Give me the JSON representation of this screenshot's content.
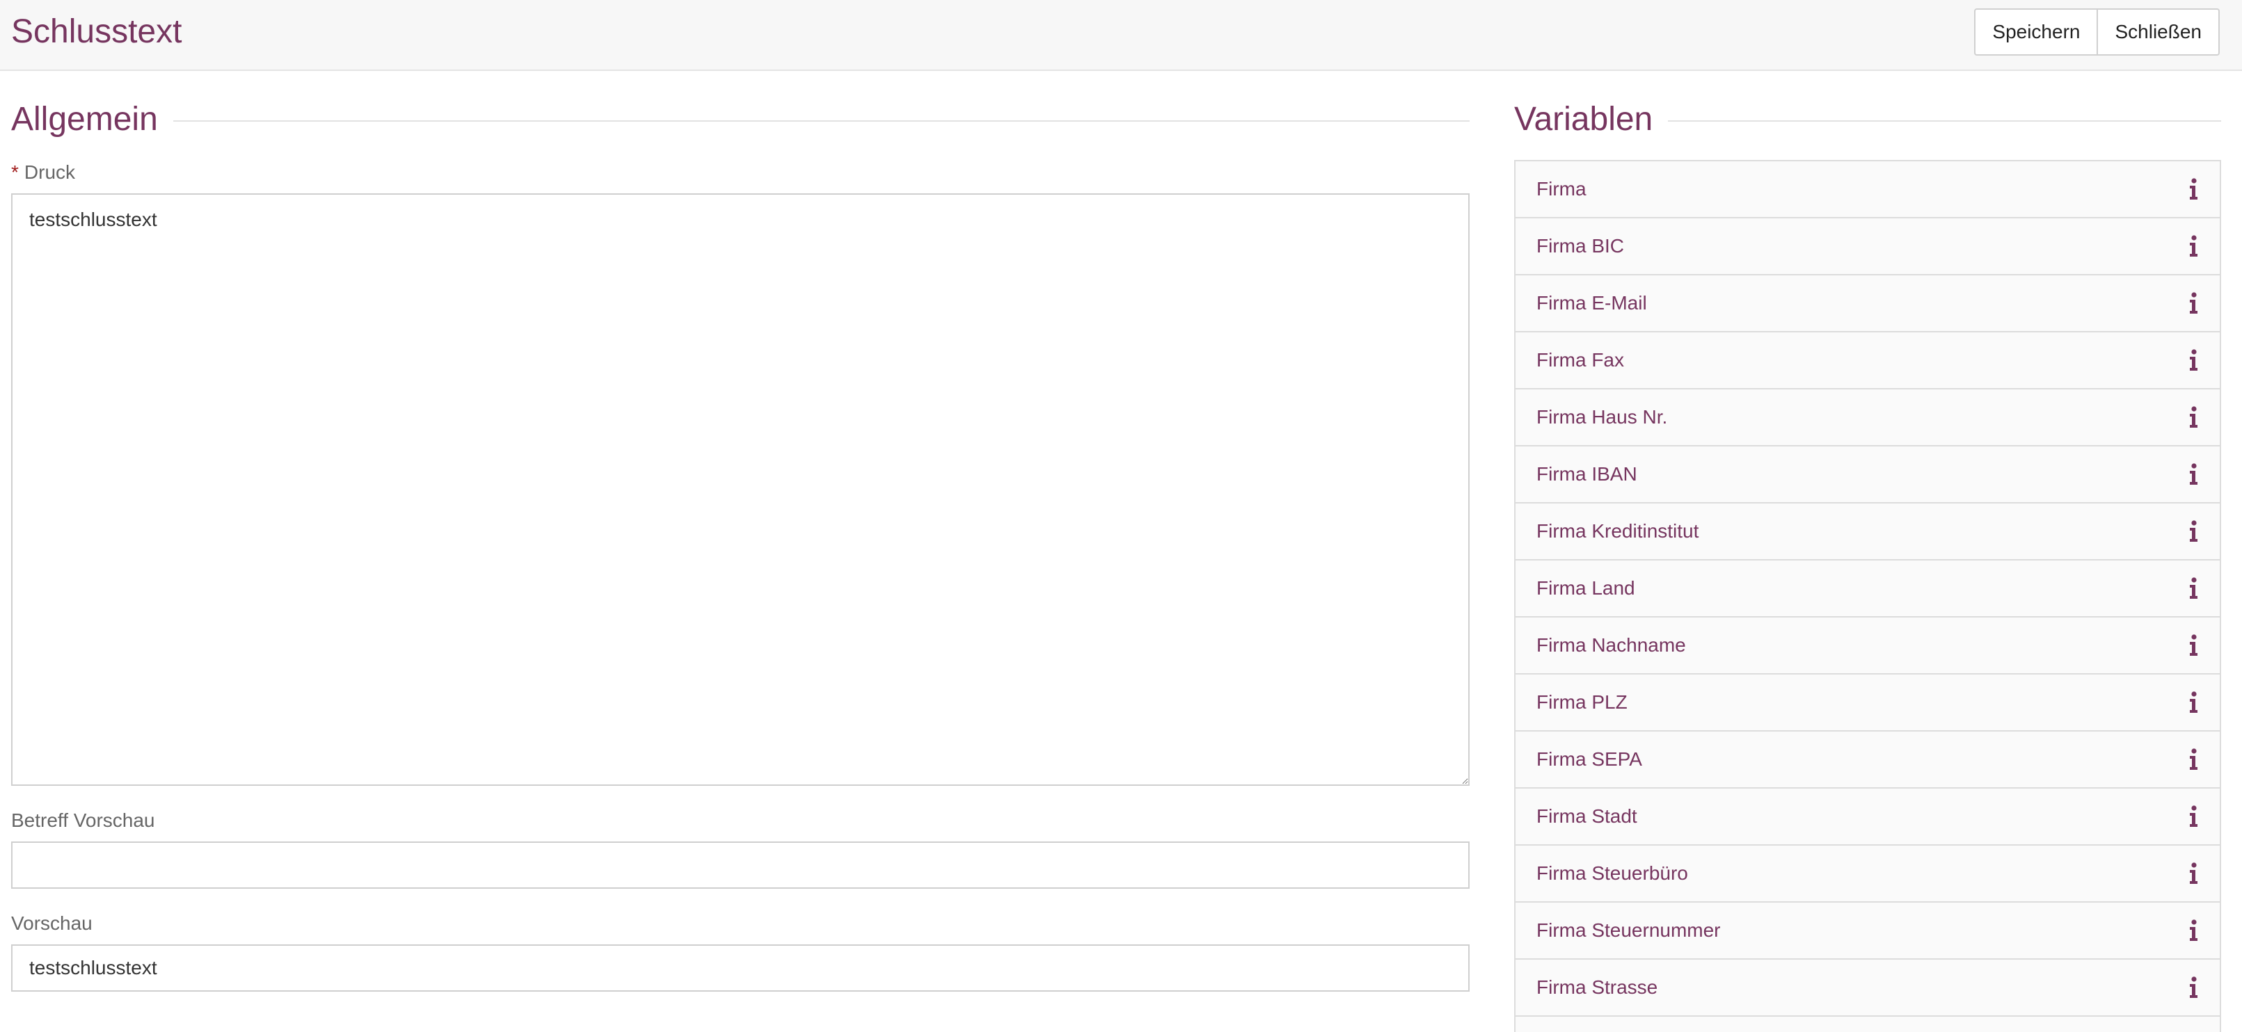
{
  "header": {
    "title": "Schlusstext",
    "save_label": "Speichern",
    "close_label": "Schließen"
  },
  "general": {
    "heading": "Allgemein",
    "druck_required_marker": "*",
    "druck_label": "Druck",
    "druck_value": "testschlusstext",
    "betreff_label": "Betreff Vorschau",
    "betreff_value": "",
    "vorschau_label": "Vorschau",
    "vorschau_value": "testschlusstext"
  },
  "variables": {
    "heading": "Variablen",
    "items": [
      {
        "label": "Firma"
      },
      {
        "label": "Firma BIC"
      },
      {
        "label": "Firma E-Mail"
      },
      {
        "label": "Firma Fax"
      },
      {
        "label": "Firma Haus Nr."
      },
      {
        "label": "Firma IBAN"
      },
      {
        "label": "Firma Kreditinstitut"
      },
      {
        "label": "Firma Land"
      },
      {
        "label": "Firma Nachname"
      },
      {
        "label": "Firma PLZ"
      },
      {
        "label": "Firma SEPA"
      },
      {
        "label": "Firma Stadt"
      },
      {
        "label": "Firma Steuerbüro"
      },
      {
        "label": "Firma Steuernummer"
      },
      {
        "label": "Firma Strasse"
      }
    ],
    "item_icon": "info-icon"
  },
  "colors": {
    "accent": "#76355f",
    "required": "#a01a1a",
    "header_bg": "#f7f7f7"
  }
}
